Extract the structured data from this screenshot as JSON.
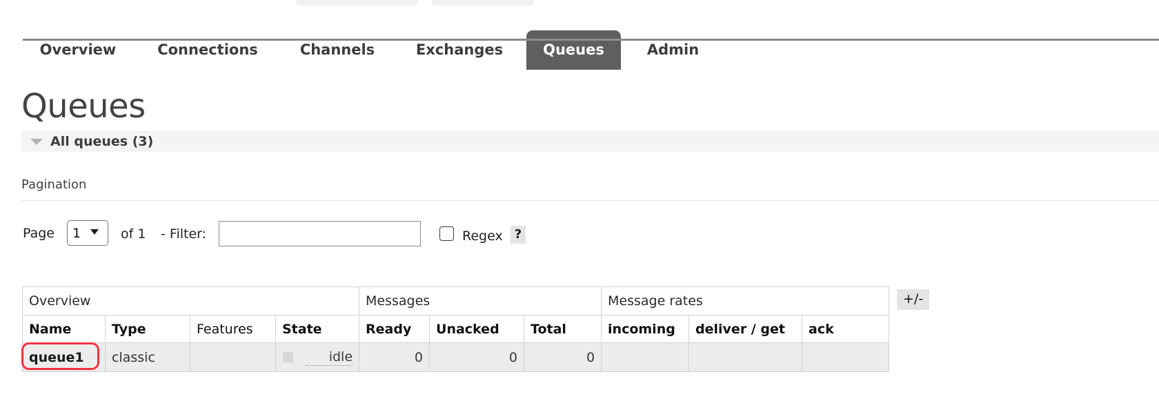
{
  "top_buttons": [
    {
      "label": "",
      "name": "cluster-button"
    },
    {
      "label": "",
      "name": "logout-button"
    }
  ],
  "nav": {
    "tabs": [
      {
        "label": "Overview",
        "key": "overview",
        "active": false
      },
      {
        "label": "Connections",
        "key": "connections",
        "active": false
      },
      {
        "label": "Channels",
        "key": "channels",
        "active": false
      },
      {
        "label": "Exchanges",
        "key": "exchanges",
        "active": false
      },
      {
        "label": "Queues",
        "key": "queues",
        "active": true
      },
      {
        "label": "Admin",
        "key": "admin",
        "active": false
      }
    ],
    "active_tab": "Queues",
    "active_tab_bg": "#605f5f",
    "active_tab_fg": "#ffffff"
  },
  "page": {
    "title": "Queues",
    "section_label": "All queues (3)",
    "queue_count": 3
  },
  "pagination": {
    "heading": "Pagination",
    "page_label": "Page",
    "page_value": "1",
    "page_options": [
      "1"
    ],
    "of_label": "of 1",
    "total_pages": 1,
    "separator": "-",
    "filter_label": "Filter:",
    "filter_value": "",
    "filter_placeholder": "",
    "regex_label": "Regex",
    "regex_checked": false,
    "help_label": "?"
  },
  "table": {
    "group_headers": [
      {
        "label": "Overview",
        "span": 4
      },
      {
        "label": "Messages",
        "span": 3
      },
      {
        "label": "Message rates",
        "span": 3
      }
    ],
    "columns": [
      {
        "label": "Name",
        "sortable": true,
        "align": "left"
      },
      {
        "label": "Type",
        "sortable": true,
        "align": "left"
      },
      {
        "label": "Features",
        "sortable": false,
        "align": "left"
      },
      {
        "label": "State",
        "sortable": true,
        "align": "left"
      },
      {
        "label": "Ready",
        "sortable": true,
        "align": "left"
      },
      {
        "label": "Unacked",
        "sortable": true,
        "align": "left"
      },
      {
        "label": "Total",
        "sortable": true,
        "align": "left"
      },
      {
        "label": "incoming",
        "sortable": true,
        "align": "left"
      },
      {
        "label": "deliver / get",
        "sortable": true,
        "align": "left"
      },
      {
        "label": "ack",
        "sortable": true,
        "align": "left"
      }
    ],
    "rows": [
      {
        "name": "queue1",
        "type": "classic",
        "features": "",
        "state": "idle",
        "ready": "0",
        "unacked": "0",
        "total": "0",
        "incoming": "",
        "deliver_get": "",
        "ack": "",
        "highlighted": true
      }
    ],
    "toggle_columns_label": "+/-"
  },
  "colors": {
    "highlight_outline": "#f5333f",
    "row_background": "#ececec",
    "active_tab": "#605f5f",
    "state_indicator": "#d6d6d6"
  }
}
